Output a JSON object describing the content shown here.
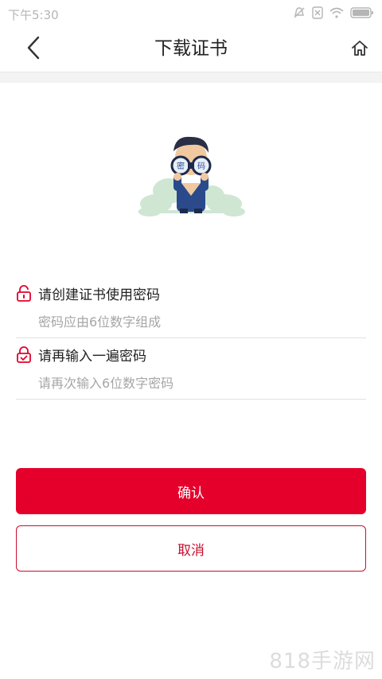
{
  "status_bar": {
    "time": "下午5:30",
    "icons": [
      "mute-icon",
      "sim-icon",
      "wifi-icon",
      "battery-icon"
    ]
  },
  "nav": {
    "title": "下载证书",
    "back_icon": "chevron-left-icon",
    "home_icon": "home-icon"
  },
  "illustration": {
    "badge_left": "密",
    "badge_right": "码"
  },
  "form": {
    "password": {
      "label": "请创建证书使用密码",
      "placeholder": "密码应由6位数字组成",
      "value": ""
    },
    "confirm_password": {
      "label": "请再输入一遍密码",
      "placeholder": "请再次输入6位数字密码",
      "value": ""
    }
  },
  "buttons": {
    "confirm": "确认",
    "cancel": "取消"
  },
  "watermark": "818手游网",
  "colors": {
    "accent": "#e4002b",
    "accent_dark": "#c8102e",
    "placeholder": "#a6a6a6",
    "divider": "#e2e2e2"
  }
}
